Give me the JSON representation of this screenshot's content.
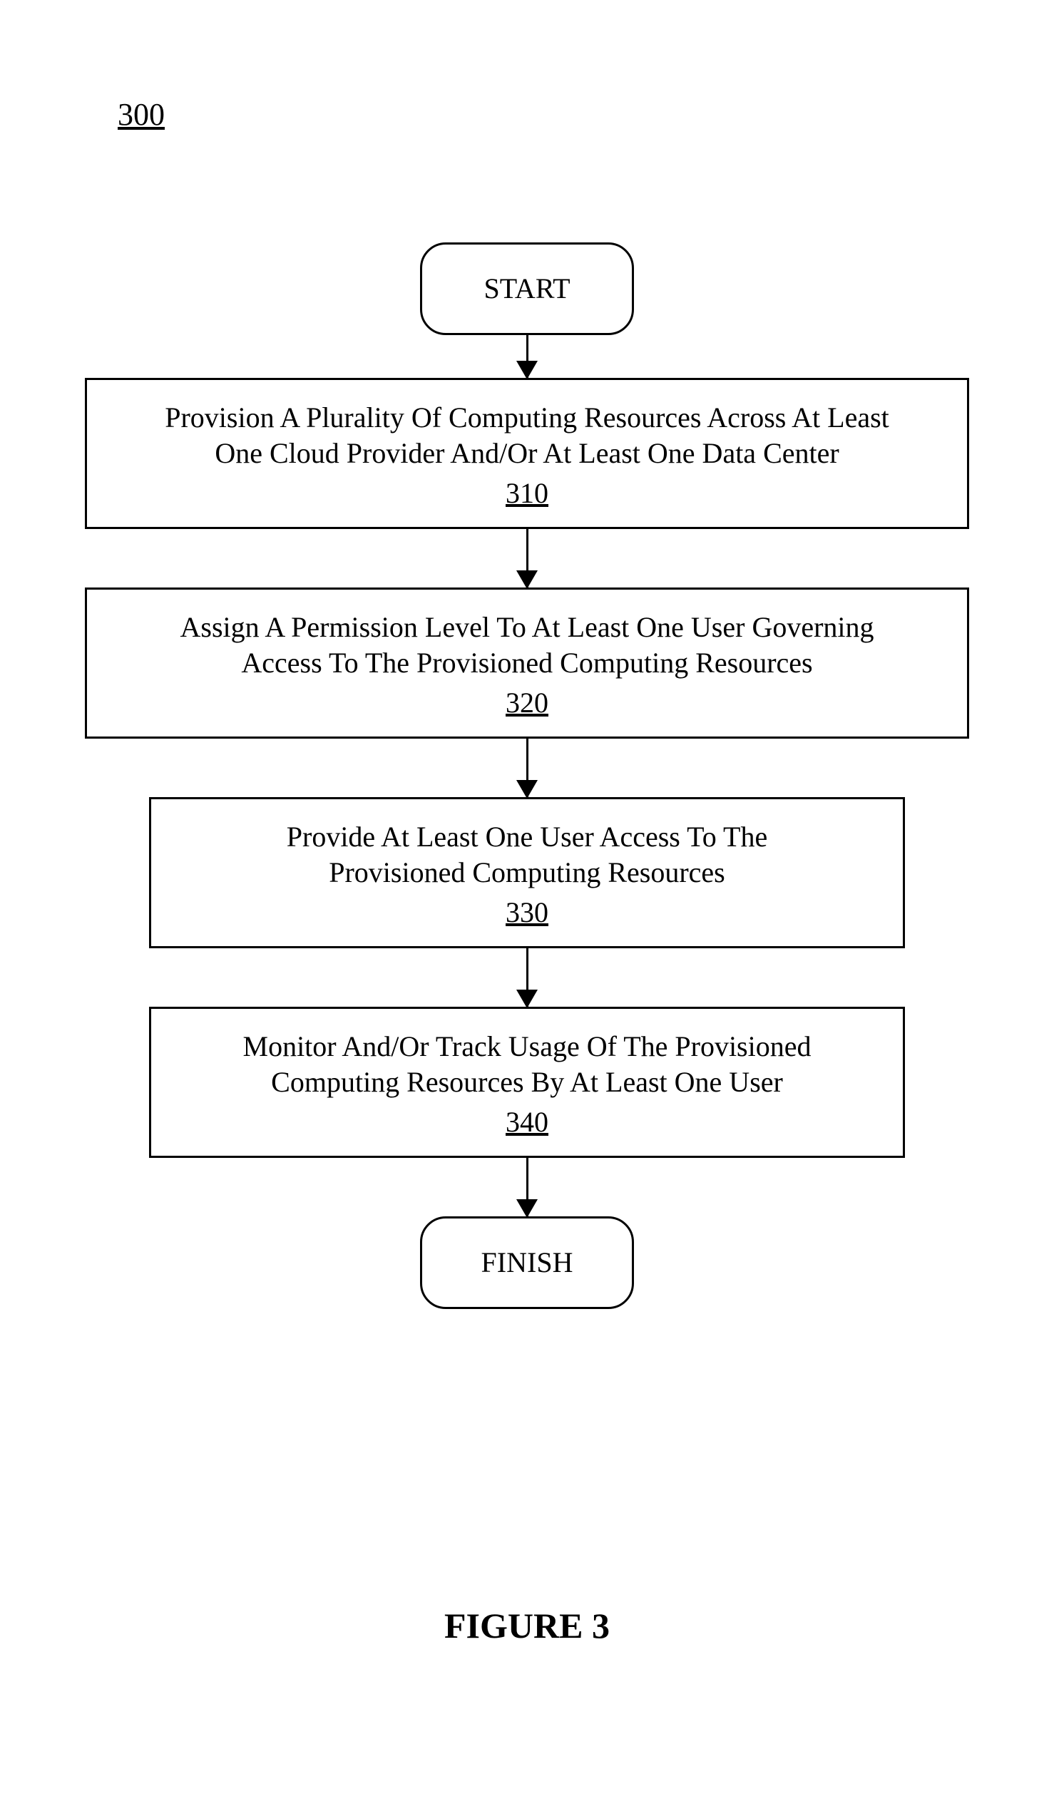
{
  "figure_number": "300",
  "start_label": "START",
  "finish_label": "FINISH",
  "steps": [
    {
      "text": "Provision A Plurality Of Computing Resources Across At Least\nOne Cloud Provider And/Or At Least One Data Center",
      "ref": "310",
      "width": "wide"
    },
    {
      "text": "Assign A Permission Level To At Least One User Governing\nAccess To The Provisioned Computing Resources",
      "ref": "320",
      "width": "wide"
    },
    {
      "text": "Provide At Least One User Access To The\nProvisioned Computing Resources",
      "ref": "330",
      "width": "narrow"
    },
    {
      "text": "Monitor And/Or Track Usage Of The Provisioned\nComputing Resources By At Least One User",
      "ref": "340",
      "width": "narrow"
    }
  ],
  "caption": "FIGURE 3"
}
